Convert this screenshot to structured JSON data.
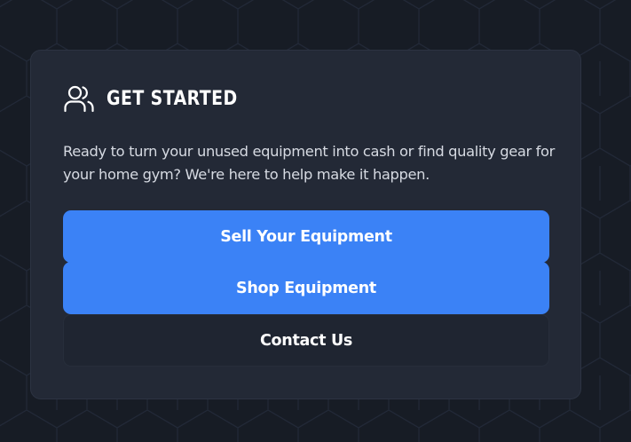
{
  "card": {
    "title": "GET STARTED",
    "icon": "users-icon",
    "description": "Ready to turn your unused equipment into cash or find quality gear for your home gym? We're here to help make it happen."
  },
  "actions": {
    "sell_label": "Sell Your Equipment",
    "shop_label": "Shop Equipment",
    "contact_label": "Contact Us"
  },
  "colors": {
    "page_background": "#171c25",
    "card_background": "#232936",
    "primary_button": "#3b82f6",
    "text_primary": "#ffffff",
    "text_secondary": "#d6dae2"
  }
}
